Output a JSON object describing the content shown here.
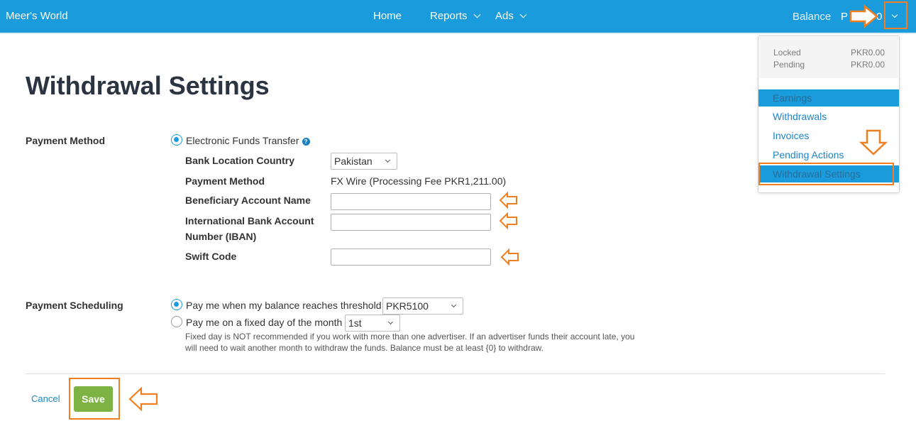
{
  "app": {
    "brand": "Meer's World",
    "nav": [
      {
        "label": "Home"
      },
      {
        "label": "Reports"
      },
      {
        "label": "Ads"
      }
    ],
    "balance_label": "Balance",
    "balance_value": "P"
  },
  "account_menu": {
    "locked_label": "Locked",
    "locked_value": "PKR0.00",
    "pending_label": "Pending",
    "pending_value": "PKR0.00",
    "items": [
      {
        "label": "Earnings",
        "active": true
      },
      {
        "label": "Withdrawals"
      },
      {
        "label": "Invoices"
      },
      {
        "label": "Pending Actions"
      },
      {
        "label": "Withdrawal Settings",
        "active": true
      }
    ]
  },
  "page": {
    "title": "Withdrawal Settings",
    "payment_method": {
      "section_label": "Payment Method",
      "option_label": "Electronic Funds Transfer",
      "help_icon": "?",
      "fields": {
        "bank_country_label": "Bank Location Country",
        "bank_country_value": "Pakistan",
        "method_label": "Payment Method",
        "method_value": "FX Wire (Processing Fee PKR1,211.00)",
        "beneficiary_label": "Beneficiary Account Name",
        "beneficiary_value": "",
        "iban_label": "International Bank Account Number (IBAN)",
        "iban_value": "",
        "swift_label": "Swift Code",
        "swift_value": ""
      }
    },
    "scheduling": {
      "section_label": "Payment Scheduling",
      "threshold_option": "Pay me when my balance reaches threshold",
      "threshold_value": "PKR5100",
      "fixed_day_option": "Pay me on a fixed day of the month",
      "fixed_day_value": "1st",
      "note": "Fixed day is NOT recommended if you work with more than one advertiser. If an advertiser funds their account late, you will need to wait another month to withdraw the funds. Balance must be at least {0} to withdraw."
    },
    "actions": {
      "cancel_label": "Cancel",
      "save_label": "Save"
    }
  },
  "colors": {
    "topbar": "#1a9bdc",
    "link": "#1a85c8",
    "annotation": "#f07f22",
    "save_button": "#7cb342"
  },
  "icons": [
    "chevron-down-icon",
    "help-icon",
    "arrow-annotation-icon",
    "radio-icon"
  ]
}
